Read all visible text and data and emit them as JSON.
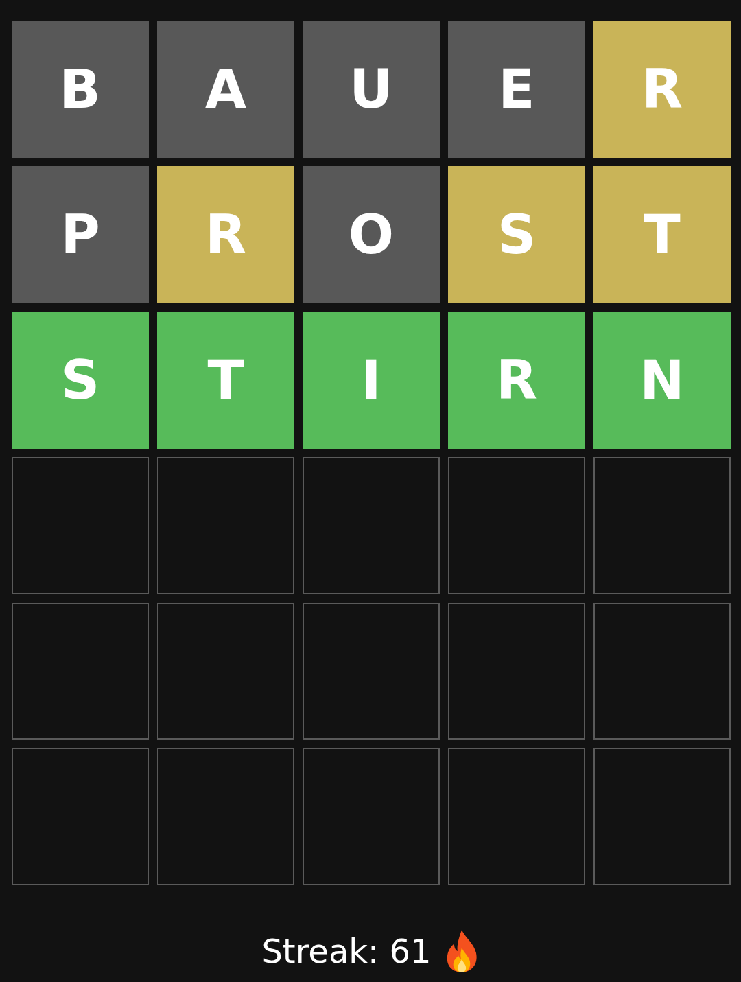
{
  "rows": [
    {
      "tiles": [
        {
          "letter": "B",
          "kind": "absent"
        },
        {
          "letter": "A",
          "kind": "absent"
        },
        {
          "letter": "U",
          "kind": "absent"
        },
        {
          "letter": "E",
          "kind": "absent"
        },
        {
          "letter": "R",
          "kind": "present"
        }
      ]
    },
    {
      "tiles": [
        {
          "letter": "P",
          "kind": "absent"
        },
        {
          "letter": "R",
          "kind": "present"
        },
        {
          "letter": "O",
          "kind": "absent"
        },
        {
          "letter": "S",
          "kind": "present"
        },
        {
          "letter": "T",
          "kind": "present"
        }
      ]
    },
    {
      "tiles": [
        {
          "letter": "S",
          "kind": "correct"
        },
        {
          "letter": "T",
          "kind": "correct"
        },
        {
          "letter": "I",
          "kind": "correct"
        },
        {
          "letter": "R",
          "kind": "correct"
        },
        {
          "letter": "N",
          "kind": "correct"
        }
      ]
    },
    {
      "tiles": [
        {
          "kind": "empty"
        },
        {
          "kind": "empty"
        },
        {
          "kind": "empty"
        },
        {
          "kind": "empty"
        },
        {
          "kind": "empty"
        }
      ]
    },
    {
      "tiles": [
        {
          "kind": "empty"
        },
        {
          "kind": "empty"
        },
        {
          "kind": "empty"
        },
        {
          "kind": "empty"
        },
        {
          "kind": "empty"
        }
      ]
    },
    {
      "tiles": [
        {
          "kind": "empty"
        },
        {
          "kind": "empty"
        },
        {
          "kind": "empty"
        },
        {
          "kind": "empty"
        },
        {
          "kind": "empty"
        }
      ]
    }
  ],
  "streak": "Streak: 61"
}
